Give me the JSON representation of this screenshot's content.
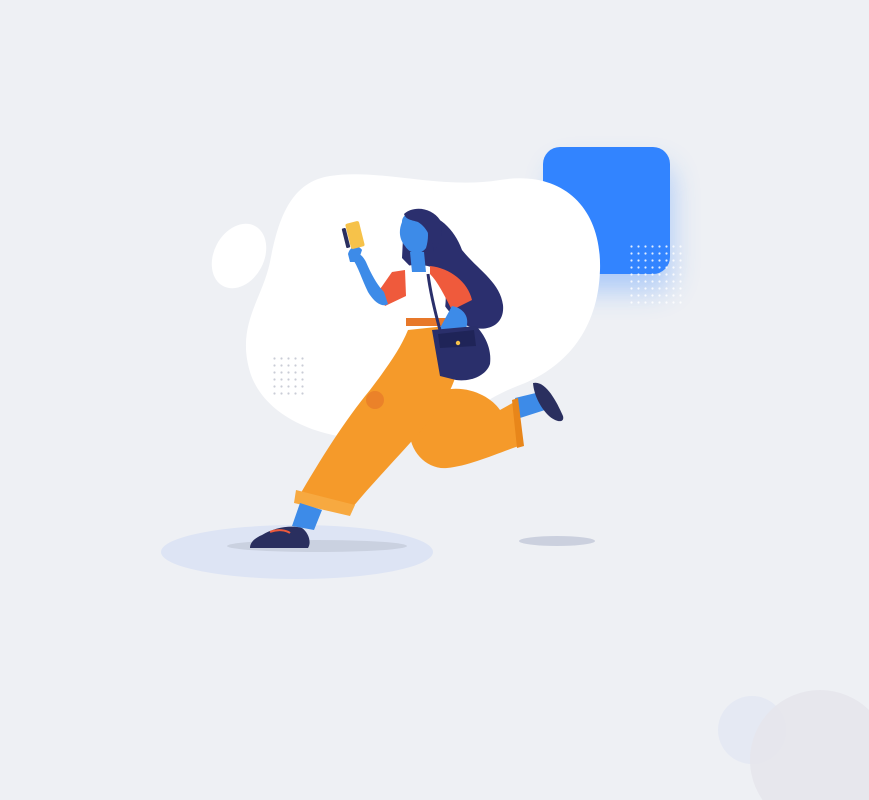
{
  "scene": {
    "background_color": "#eef0f4",
    "accent_color": "#3284ff",
    "blob_color": "#ffffff",
    "shadow_color": "#dde4f4",
    "skin_color": "#3d8be8",
    "hair_color": "#2b2f6e",
    "shirt_sleeve_color": "#ef5a3c",
    "shirt_color": "#ffffff",
    "pants_color": "#f59a2a",
    "bag_color": "#2a2f6b",
    "shoe_color": "#2a2f5f",
    "phone_color": "#f6c24a",
    "elements": [
      "blue-rounded-square",
      "white-blob",
      "small-white-oval",
      "dot-grid",
      "running-woman-reading-phone",
      "ground-shadows",
      "corner-circles"
    ]
  }
}
